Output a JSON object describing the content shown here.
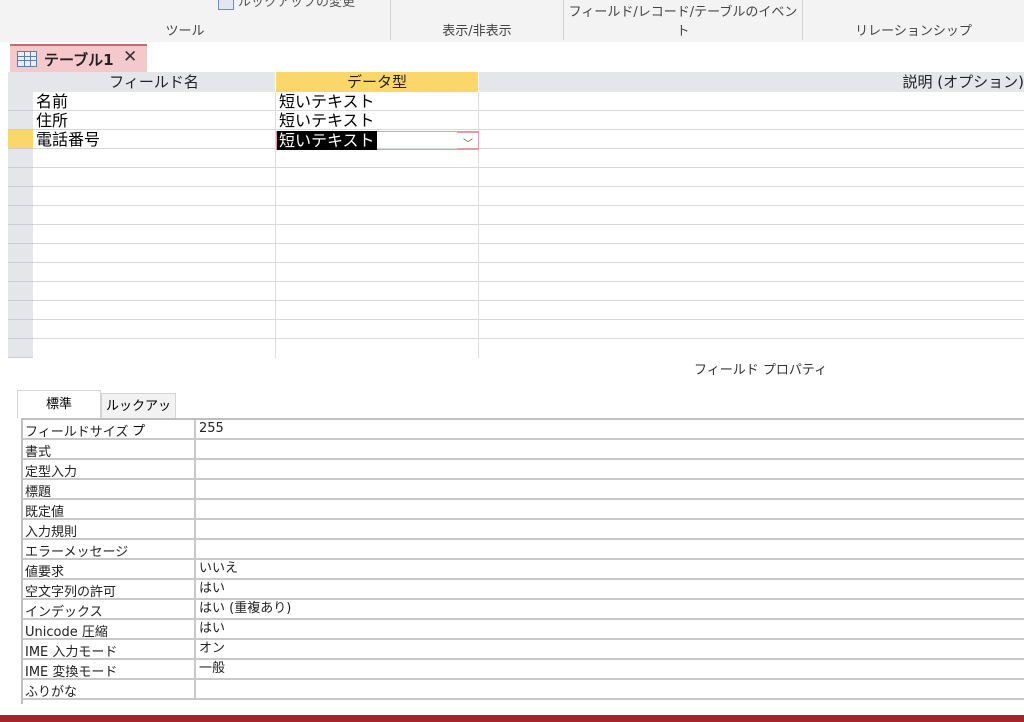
{
  "ribbon": {
    "cut_text": "ルックアップの変更",
    "groups": [
      "ツール",
      "表示/非表示",
      "フィールド/レコード/テーブルのイベント",
      "リレーションシップ"
    ]
  },
  "doc_tab": {
    "title": "テーブル1",
    "close": "✕"
  },
  "grid": {
    "headers": {
      "field_name": "フィールド名",
      "data_type": "データ型",
      "description": "説明 (オプション)"
    },
    "rows": [
      {
        "field": "名前",
        "type": "短いテキスト"
      },
      {
        "field": "住所",
        "type": "短いテキスト"
      },
      {
        "field": "電話番号",
        "type": "短いテキスト"
      }
    ]
  },
  "field_properties_title": "フィールド プロパティ",
  "prop_tabs": {
    "standard": "標準",
    "lookup": "ルックアップ"
  },
  "properties": [
    {
      "label": "フィールドサイズ",
      "value": "255"
    },
    {
      "label": "書式",
      "value": ""
    },
    {
      "label": "定型入力",
      "value": ""
    },
    {
      "label": "標題",
      "value": ""
    },
    {
      "label": "既定値",
      "value": ""
    },
    {
      "label": "入力規則",
      "value": ""
    },
    {
      "label": "エラーメッセージ",
      "value": ""
    },
    {
      "label": "値要求",
      "value": "いいえ"
    },
    {
      "label": "空文字列の許可",
      "value": "はい"
    },
    {
      "label": "インデックス",
      "value": "はい (重複あり)"
    },
    {
      "label": "Unicode 圧縮",
      "value": "はい"
    },
    {
      "label": "IME 入力モード",
      "value": "オン"
    },
    {
      "label": "IME 変換モード",
      "value": "一般"
    },
    {
      "label": "ふりがな",
      "value": ""
    }
  ],
  "colors": {
    "accent": "#fbd76a",
    "tab": "#f5c8cc",
    "brand": "#a4262c"
  }
}
